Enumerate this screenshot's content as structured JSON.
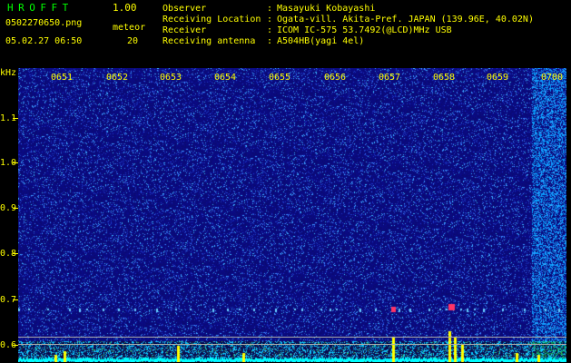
{
  "header": {
    "title": "HROFFT",
    "version": "1.00",
    "filename": "0502270650.png",
    "datetime": "05.02.27 06:50",
    "meteor_label": "meteor",
    "meteor_count": "20"
  },
  "info": [
    {
      "label": "Observer",
      "value": "Masayuki Kobayashi"
    },
    {
      "label": "Receiving Location",
      "value": "Ogata-vill. Akita-Pref. JAPAN (139.96E, 40.02N)"
    },
    {
      "label": "Receiver",
      "value": "ICOM IC-575 53.7492(@LCD)MHz USB"
    },
    {
      "label": "Receiving antenna",
      "value": "A504HB(yagi 4el)"
    }
  ],
  "colon": ":",
  "spectrogram": {
    "y_unit": "kHz",
    "y_ticks": [
      "1.1",
      "1.0",
      "0.9",
      "0.8",
      "0.7",
      "0.6"
    ],
    "time_ticks": [
      "0651",
      "0652",
      "0653",
      "0654",
      "0655",
      "0656",
      "0657",
      "0658",
      "0659",
      "0700"
    ],
    "colors": {
      "background": "#0a0a7a",
      "text": "#ffff00",
      "title": "#00ff00",
      "signal": "#ff3366",
      "baseline": "#00ffff"
    }
  }
}
